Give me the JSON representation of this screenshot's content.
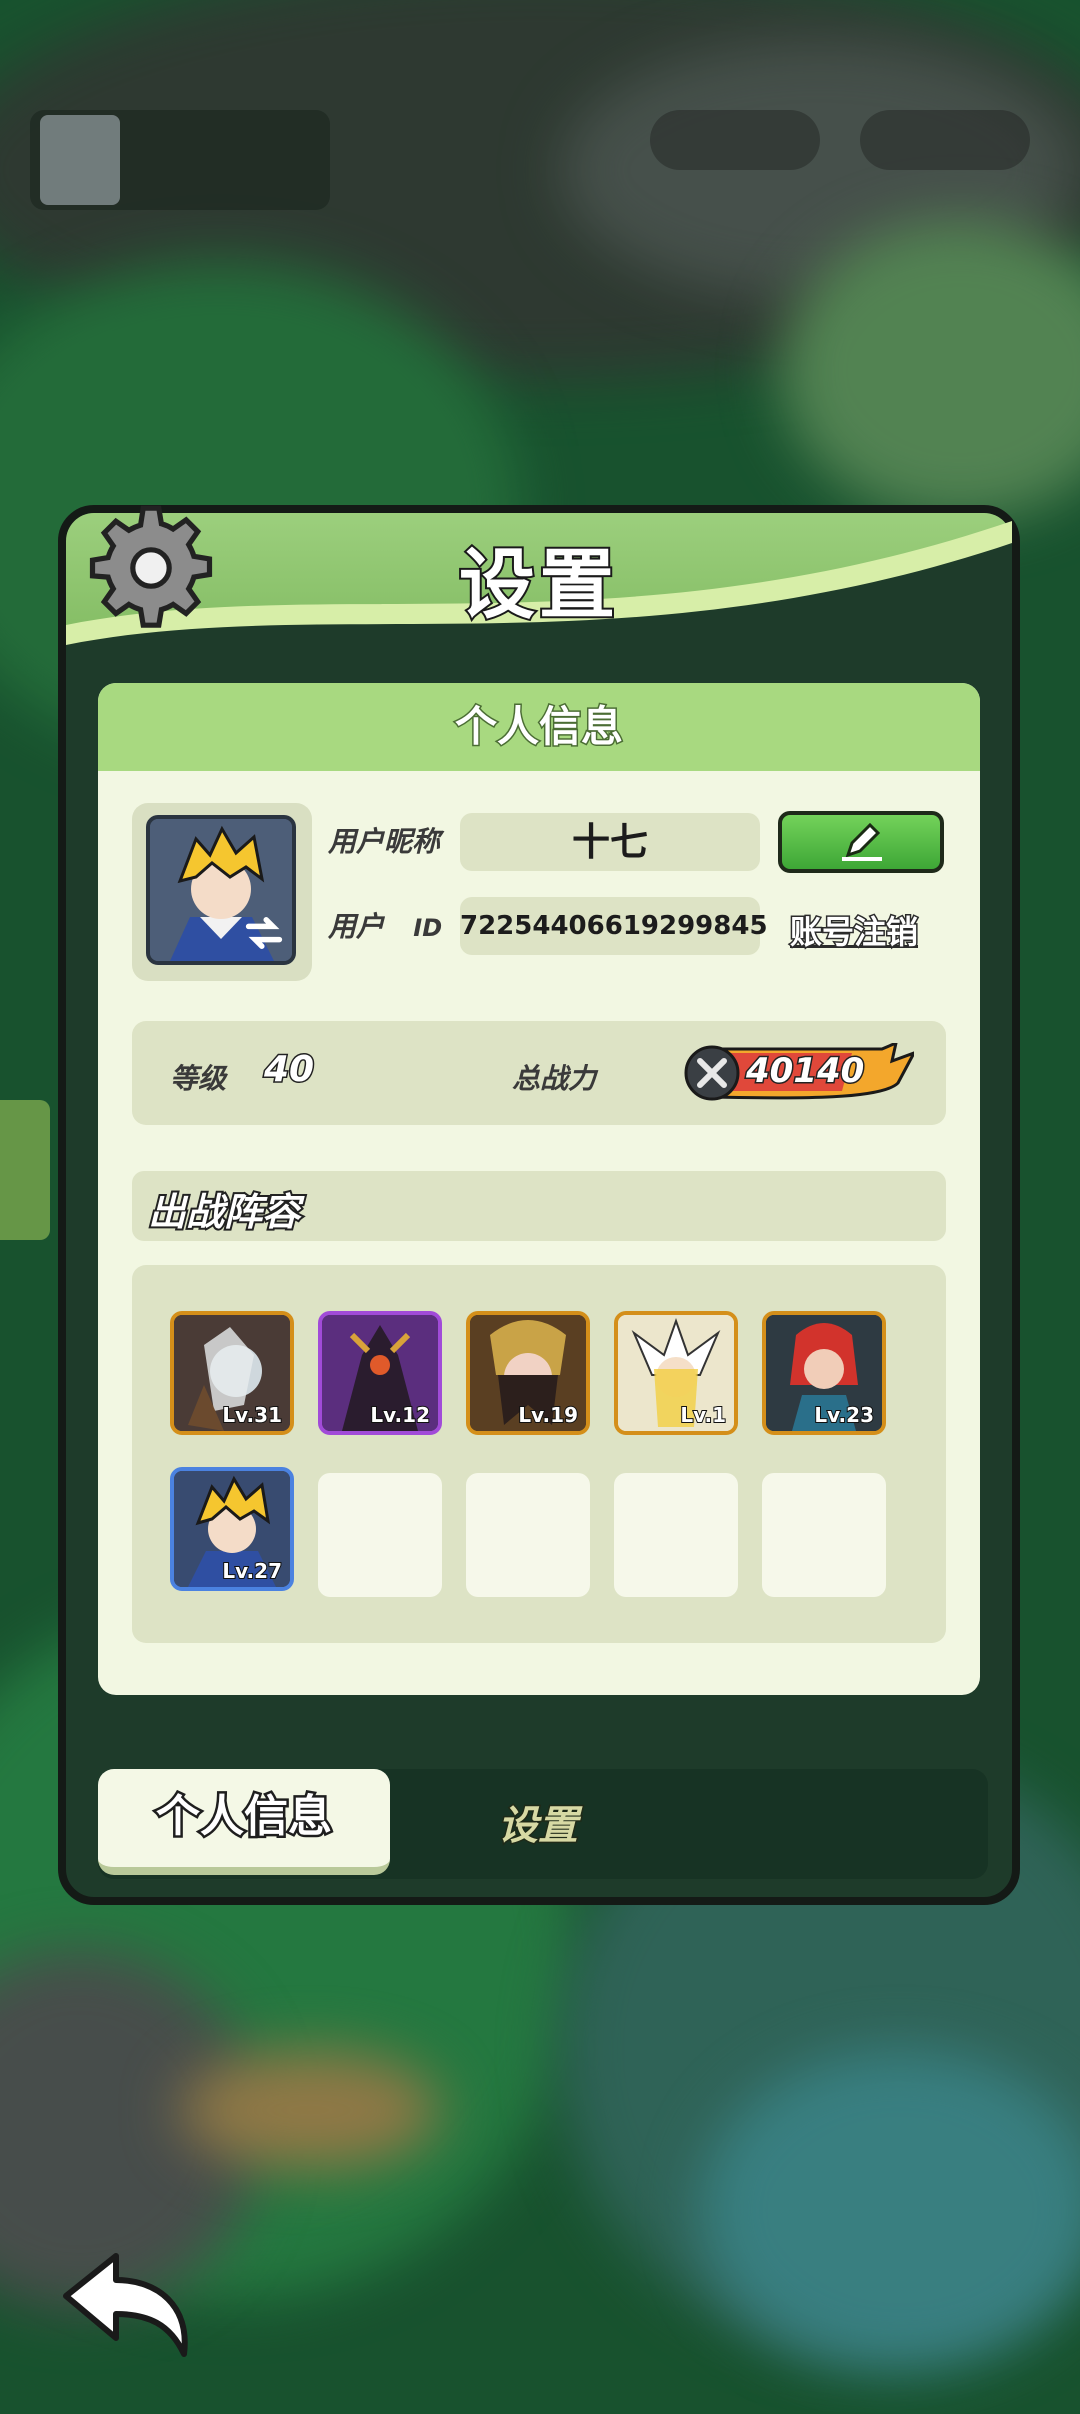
{
  "dialog": {
    "title": "设置"
  },
  "panel": {
    "header": "个人信息"
  },
  "profile": {
    "nickname_label": "用户昵称",
    "nickname": "十七",
    "id_label": "用户",
    "id_label2": "ID",
    "user_id": "72254406619299845",
    "logout_link": "账号注销"
  },
  "stats": {
    "level_label": "等级",
    "level": "40",
    "power_label": "总战力",
    "power": "40140"
  },
  "lineup": {
    "title": "出战阵容",
    "heroes": [
      {
        "level": "Lv.31",
        "color": "#d48f1a"
      },
      {
        "level": "Lv.12",
        "color": "#a14bd8"
      },
      {
        "level": "Lv.19",
        "color": "#d48f1a"
      },
      {
        "level": "Lv.1",
        "color": "#d48f1a"
      },
      {
        "level": "Lv.23",
        "color": "#d48f1a"
      },
      {
        "level": "Lv.27",
        "color": "#4b82e0"
      }
    ]
  },
  "tabs": {
    "active": "个人信息",
    "inactive": "设置"
  },
  "colors": {
    "accent_green": "#a8d980",
    "panel_bg": "#f2f7e2",
    "dialog_bg": "#1e3b2a"
  }
}
